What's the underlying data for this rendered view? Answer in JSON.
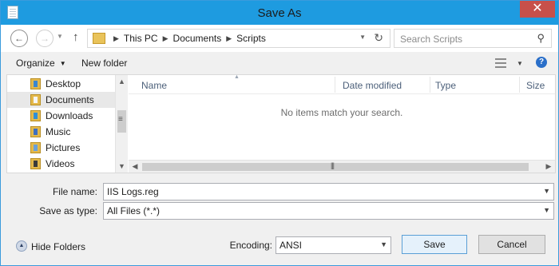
{
  "window": {
    "title": "Save As",
    "close_glyph": "✕"
  },
  "nav": {
    "back_icon": "back-arrow-icon",
    "forward_icon": "forward-arrow-icon",
    "up_icon": "up-arrow-icon",
    "breadcrumbs": [
      "This PC",
      "Documents",
      "Scripts"
    ],
    "search_placeholder": "Search Scripts"
  },
  "toolbar": {
    "organize": "Organize",
    "new_folder": "New folder"
  },
  "sidebar": {
    "items": [
      {
        "label": "Desktop",
        "icon": "desktop-folder-icon"
      },
      {
        "label": "Documents",
        "icon": "documents-folder-icon",
        "selected": true
      },
      {
        "label": "Downloads",
        "icon": "downloads-folder-icon"
      },
      {
        "label": "Music",
        "icon": "music-folder-icon"
      },
      {
        "label": "Pictures",
        "icon": "pictures-folder-icon"
      },
      {
        "label": "Videos",
        "icon": "videos-folder-icon"
      }
    ]
  },
  "file_list": {
    "columns": [
      "Name",
      "Date modified",
      "Type",
      "Size"
    ],
    "empty_message": "No items match your search."
  },
  "form": {
    "file_name_label": "File name:",
    "file_name_value": "IIS Logs.reg",
    "save_type_label": "Save as type:",
    "save_type_value": "All Files  (*.*)",
    "encoding_label": "Encoding:",
    "encoding_value": "ANSI"
  },
  "footer": {
    "hide_folders": "Hide Folders",
    "save_button": "Save",
    "cancel_button": "Cancel"
  },
  "colors": {
    "titlebar": "#1e9be0",
    "close_button": "#c7504a",
    "selection": "#e8e8e8",
    "header_text": "#4c607a",
    "default_button_border": "#5a9fd6"
  }
}
